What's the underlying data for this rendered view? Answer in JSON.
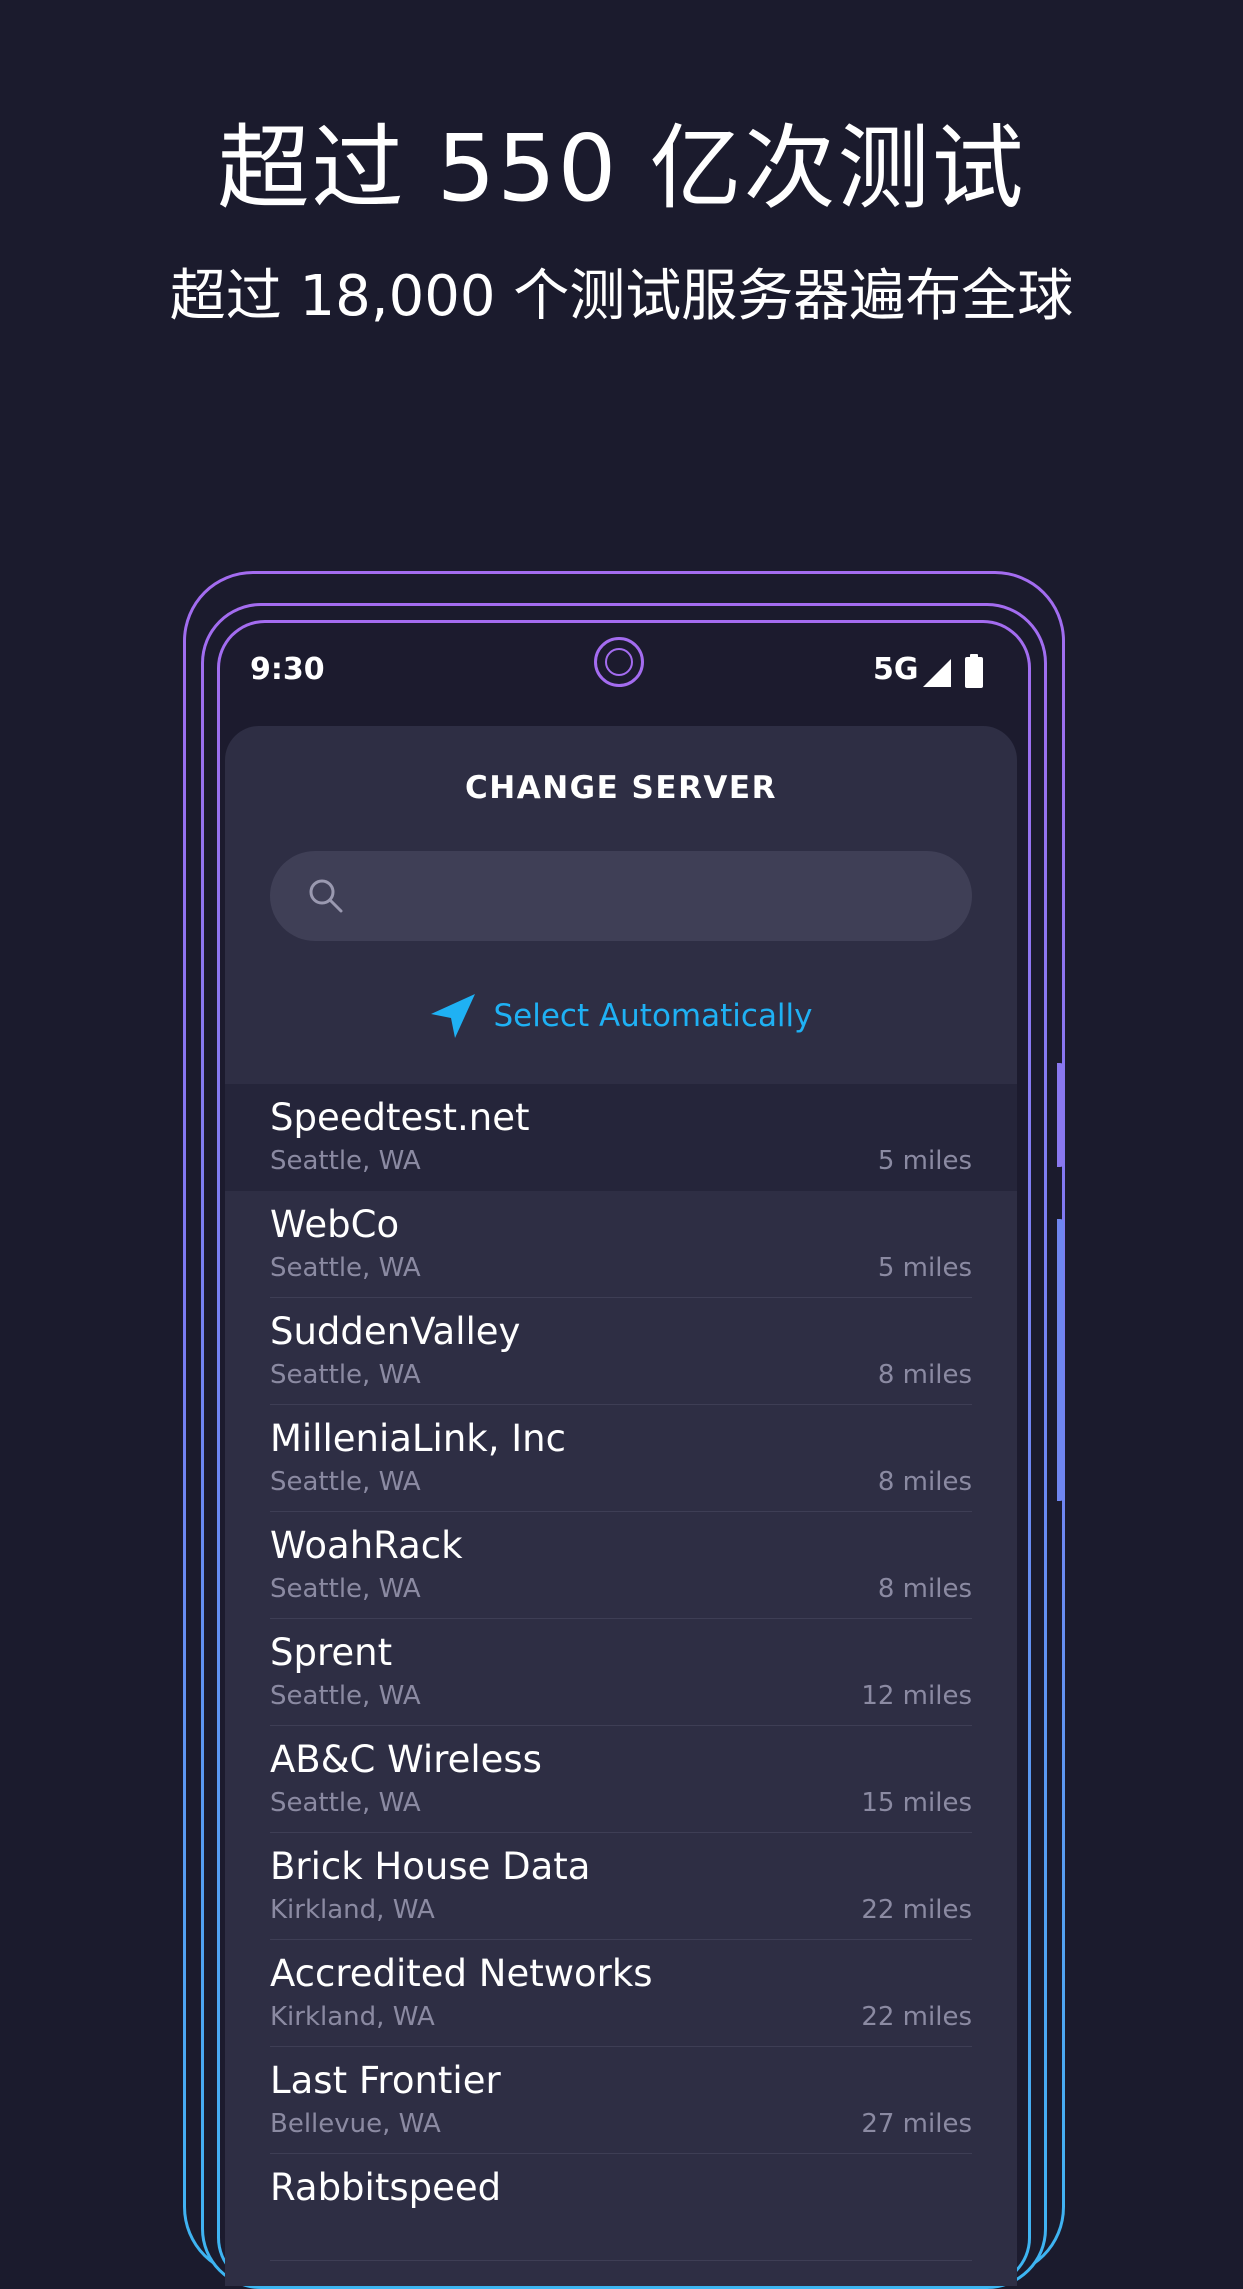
{
  "promo": {
    "headline": "超过 550 亿次测试",
    "subheadline": "超过 18,000 个测试服务器遍布全球"
  },
  "status_bar": {
    "time": "9:30",
    "network": "5G",
    "signal_icon": "signal-icon",
    "battery_icon": "battery-icon"
  },
  "panel": {
    "title": "CHANGE SERVER",
    "search_placeholder": "",
    "search_icon": "search-icon",
    "auto_select_label": "Select Automatically",
    "auto_select_icon": "navigation-arrow-icon"
  },
  "servers": [
    {
      "name": "Speedtest.net",
      "location": "Seattle, WA",
      "distance": "5 miles",
      "selected": true
    },
    {
      "name": "WebCo",
      "location": "Seattle, WA",
      "distance": "5 miles",
      "selected": false
    },
    {
      "name": "SuddenValley",
      "location": "Seattle, WA",
      "distance": "8 miles",
      "selected": false
    },
    {
      "name": "MilleniaLink, Inc",
      "location": "Seattle, WA",
      "distance": "8 miles",
      "selected": false
    },
    {
      "name": "WoahRack",
      "location": "Seattle, WA",
      "distance": "8 miles",
      "selected": false
    },
    {
      "name": "Sprent",
      "location": "Seattle, WA",
      "distance": "12 miles",
      "selected": false
    },
    {
      "name": "AB&C Wireless",
      "location": "Seattle, WA",
      "distance": "15 miles",
      "selected": false
    },
    {
      "name": "Brick House Data",
      "location": "Kirkland, WA",
      "distance": "22 miles",
      "selected": false
    },
    {
      "name": "Accredited Networks",
      "location": "Kirkland, WA",
      "distance": "22 miles",
      "selected": false
    },
    {
      "name": "Last Frontier",
      "location": "Bellevue, WA",
      "distance": "27 miles",
      "selected": false
    },
    {
      "name": "Rabbitspeed",
      "location": "",
      "distance": "",
      "selected": false
    }
  ],
  "colors": {
    "background": "#1b1b2d",
    "panel": "#2e2e44",
    "accent": "#1fb1f4",
    "frame_top": "#a46cf0",
    "frame_bottom": "#3cb6f2"
  }
}
